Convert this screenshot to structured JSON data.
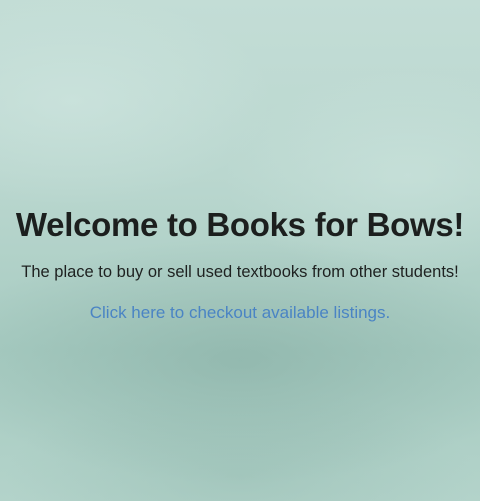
{
  "hero": {
    "title": "Welcome to Books for Bows!",
    "tagline": "The place to buy or sell used textbooks from other students!",
    "cta_link": "Click here to checkout available listings."
  },
  "colors": {
    "background": "#bad7cf",
    "text": "#1c1f1e",
    "link": "#4a84c4"
  }
}
